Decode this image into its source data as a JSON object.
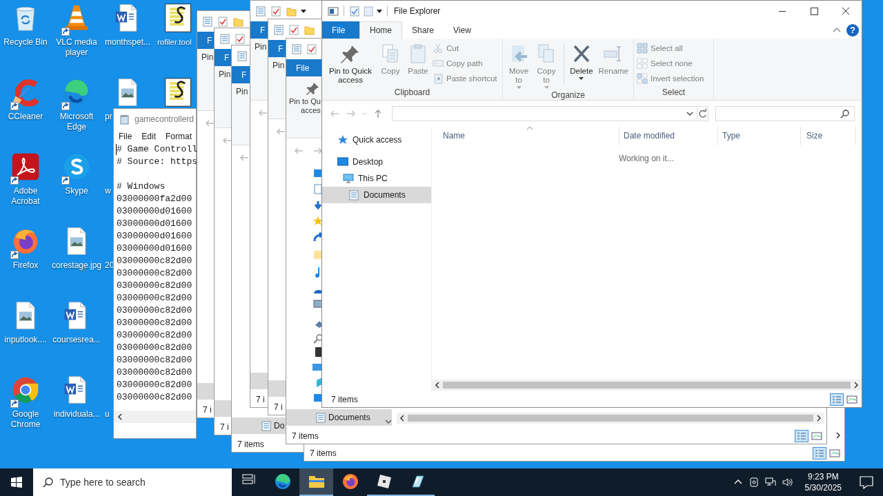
{
  "desktop": {
    "icons": [
      {
        "label": "Recycle Bin",
        "kind": "recycle",
        "shortcut": false
      },
      {
        "label": "CCleaner",
        "kind": "ccleaner",
        "shortcut": true
      },
      {
        "label": "Adobe Acrobat",
        "kind": "acrobat",
        "shortcut": true
      },
      {
        "label": "Firefox",
        "kind": "firefox",
        "shortcut": true
      },
      {
        "label": "inputlook....",
        "kind": "image",
        "shortcut": false
      },
      {
        "label": "Google Chrome",
        "kind": "chrome",
        "shortcut": true
      },
      {
        "label": "VLC media player",
        "kind": "vlc",
        "shortcut": true
      },
      {
        "label": "Microsoft Edge",
        "kind": "edge",
        "shortcut": true
      },
      {
        "label": "Skype",
        "kind": "skype",
        "shortcut": true
      },
      {
        "label": "corestage.jpg",
        "kind": "image",
        "shortcut": false
      },
      {
        "label": "coursesrea...",
        "kind": "word",
        "shortcut": false
      },
      {
        "label": "individuala...",
        "kind": "word",
        "shortcut": false
      },
      {
        "label": "monthspet...",
        "kind": "word",
        "shortcut": false
      },
      {
        "label": "pr",
        "kind": "image",
        "shortcut": false
      },
      {
        "label": "w"
      },
      {
        "label": "20"
      },
      {
        "label": "u"
      },
      {
        "label": "rofiler.tool",
        "kind": "script",
        "shortcut": false
      },
      {
        "kind": "script",
        "shortcut": false
      }
    ]
  },
  "notepad": {
    "title": "gamecontrollerd",
    "menu": [
      "File",
      "Edit",
      "Format"
    ],
    "text_blocks": [
      [
        "# Game Controll",
        "# Source: https"
      ],
      [
        "# Windows",
        "03000000fa2d00",
        "03000000d01600",
        "03000000d01600",
        "03000000d01600",
        "03000000d01600",
        "03000000c82d00",
        "03000000c82d00",
        "03000000c82d00",
        "03000000c82d00",
        "03000000c82d00",
        "03000000c82d00",
        "03000000c82d00",
        "03000000c82d00",
        "03000000c82d00",
        "03000000c82d00",
        "03000000c82d00",
        "03000000c82d00"
      ]
    ]
  },
  "background_windows": [
    {
      "file_tab": "F",
      "pin_label": [
        "Pin"
      ],
      "status": "7 i"
    },
    {
      "file_tab": "F",
      "pin_label": [
        "Pin"
      ],
      "status": "7 i"
    },
    {
      "file_tab": "F",
      "pin_label": [
        "Pin"
      ],
      "nav_item": "Do",
      "status": "7 items"
    },
    {
      "file_tab": "F",
      "pin_label": [
        "Pin"
      ],
      "status": "7 i"
    },
    {
      "file_tab": "F",
      "pin_label": [
        "Pin"
      ],
      "status": "7 i"
    },
    {
      "file_tab": "File",
      "pin_label": [
        "Pin to Qu",
        "acces"
      ],
      "nav_item": "Documents",
      "status": "7 items"
    },
    {
      "status": "7 items"
    }
  ],
  "explorer": {
    "title": "File Explorer",
    "tabs": [
      {
        "label": "File",
        "kind": "file",
        "selected": false
      },
      {
        "label": "Home",
        "kind": "tab",
        "selected": true
      },
      {
        "label": "Share",
        "kind": "tab",
        "selected": false
      },
      {
        "label": "View",
        "kind": "tab",
        "selected": false
      }
    ],
    "help": "?",
    "ribbon_groups": [
      {
        "label": "Clipboard",
        "large": [
          {
            "label": "Pin to Quick access",
            "kind": "pin",
            "disabled": false
          },
          {
            "label": "Copy",
            "kind": "copy",
            "disabled": true
          },
          {
            "label": "Paste",
            "kind": "paste",
            "disabled": true
          }
        ],
        "small": [
          {
            "label": "Cut",
            "kind": "cut",
            "disabled": true
          },
          {
            "label": "Copy path",
            "kind": "copypath",
            "disabled": true
          },
          {
            "label": "Paste shortcut",
            "kind": "shortcut",
            "disabled": true
          }
        ]
      },
      {
        "label": "Organize",
        "large": [
          {
            "label": "Move to",
            "kind": "move",
            "disabled": true,
            "dropdown": true
          },
          {
            "label": "Copy to",
            "kind": "copyto",
            "disabled": true,
            "dropdown": true
          },
          {
            "label": "Delete",
            "kind": "delete",
            "disabled": false,
            "dropdown": true
          },
          {
            "label": "Rename",
            "kind": "rename",
            "disabled": true
          }
        ]
      },
      {
        "label": "Select",
        "small": [
          {
            "label": "Select all",
            "kind": "selectall",
            "disabled": true
          },
          {
            "label": "Select none",
            "kind": "selectnone",
            "disabled": true
          },
          {
            "label": "Invert selection",
            "kind": "invert",
            "disabled": true
          }
        ]
      }
    ],
    "nav": [
      {
        "label": "Quick access",
        "kind": "star",
        "selected": false
      },
      {
        "label": "Desktop",
        "kind": "desktop",
        "selected": false,
        "children": [
          {
            "label": "This PC",
            "kind": "pc",
            "selected": false,
            "children": [
              {
                "label": "Documents",
                "kind": "documents",
                "selected": true
              }
            ]
          }
        ]
      }
    ],
    "columns": [
      "Name",
      "Date modified",
      "Type",
      "Size"
    ],
    "message": "Working on it...",
    "status": "7 items"
  },
  "taskbar": {
    "search_placeholder": "Type here to search",
    "apps": [
      {
        "kind": "taskview",
        "active": false,
        "running": false
      },
      {
        "kind": "edge",
        "active": false,
        "running": false
      },
      {
        "kind": "explorer",
        "active": true,
        "running": true
      },
      {
        "kind": "firefox",
        "active": false,
        "running": false
      },
      {
        "kind": "cube",
        "active": false,
        "running": true
      },
      {
        "kind": "glass",
        "active": false,
        "running": true
      }
    ],
    "time": "9:23 PM",
    "date": "5/30/2025"
  }
}
